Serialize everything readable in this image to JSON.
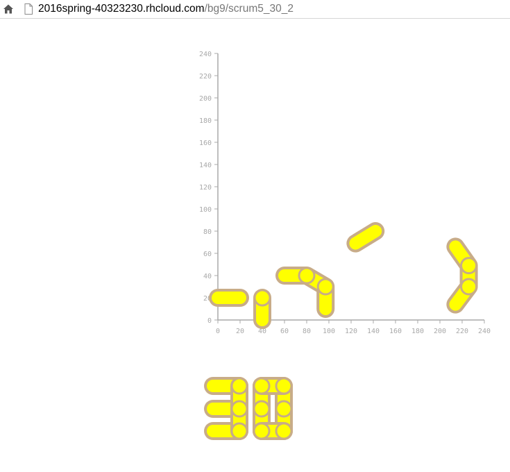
{
  "browser": {
    "url_host": "2016spring-40323230.rhcloud.com",
    "url_path": "/bg9/scrum5_30_2",
    "home_icon": "home-icon",
    "page_icon": "page-icon"
  },
  "axes": {
    "x_ticks": [
      "0",
      "20",
      "40",
      "60",
      "80",
      "100",
      "120",
      "140",
      "160",
      "180",
      "200",
      "220",
      "240"
    ],
    "y_ticks": [
      "0",
      "20",
      "40",
      "60",
      "80",
      "100",
      "120",
      "140",
      "160",
      "180",
      "200",
      "220",
      "240"
    ],
    "xlim": [
      0,
      240
    ],
    "ylim": [
      0,
      240
    ],
    "axis_color": "#a8a8a8"
  },
  "colors": {
    "piece_fill": "#ffff00",
    "piece_outline": "#c8ac88"
  },
  "pieces": [
    {
      "name": "link-0-20",
      "points": [
        [
          0,
          20
        ],
        [
          20,
          20
        ]
      ]
    },
    {
      "name": "link-40-vertical",
      "points": [
        [
          40,
          20
        ],
        [
          40,
          0
        ]
      ]
    },
    {
      "name": "link-60-40",
      "points": [
        [
          60,
          40
        ],
        [
          80,
          40
        ],
        [
          97,
          30
        ],
        [
          97,
          10
        ]
      ]
    },
    {
      "name": "link-diagonal",
      "points": [
        [
          124,
          69
        ],
        [
          142,
          80
        ]
      ]
    },
    {
      "name": "link-arc",
      "points": [
        [
          214,
          66
        ],
        [
          226,
          49
        ],
        [
          226,
          30
        ],
        [
          214,
          14
        ]
      ]
    }
  ],
  "digit_pieces": [
    {
      "name": "digit3-bar-top",
      "points": [
        [
          307,
          556
        ],
        [
          345,
          556
        ]
      ]
    },
    {
      "name": "digit3-bar-mid",
      "points": [
        [
          307,
          589
        ],
        [
          345,
          589
        ]
      ]
    },
    {
      "name": "digit3-bar-bot",
      "points": [
        [
          307,
          621
        ],
        [
          345,
          621
        ]
      ]
    },
    {
      "name": "digit3-right",
      "points": [
        [
          345,
          556
        ],
        [
          345,
          621
        ]
      ]
    },
    {
      "name": "digit0-left",
      "points": [
        [
          377,
          556
        ],
        [
          377,
          621
        ]
      ]
    },
    {
      "name": "digit0-right",
      "points": [
        [
          409,
          556
        ],
        [
          409,
          621
        ]
      ]
    },
    {
      "name": "digit0-top",
      "points": [
        [
          377,
          556
        ],
        [
          409,
          556
        ]
      ]
    },
    {
      "name": "digit0-bot",
      "points": [
        [
          377,
          621
        ],
        [
          409,
          621
        ]
      ]
    }
  ],
  "digit_joints": [
    [
      345,
      556
    ],
    [
      345,
      589
    ],
    [
      345,
      621
    ],
    [
      377,
      556
    ],
    [
      377,
      589
    ],
    [
      377,
      621
    ],
    [
      409,
      556
    ],
    [
      409,
      589
    ],
    [
      409,
      621
    ]
  ],
  "joints": [
    [
      40,
      20
    ],
    [
      80,
      40
    ],
    [
      97,
      30
    ],
    [
      226,
      49
    ],
    [
      226,
      30
    ]
  ]
}
